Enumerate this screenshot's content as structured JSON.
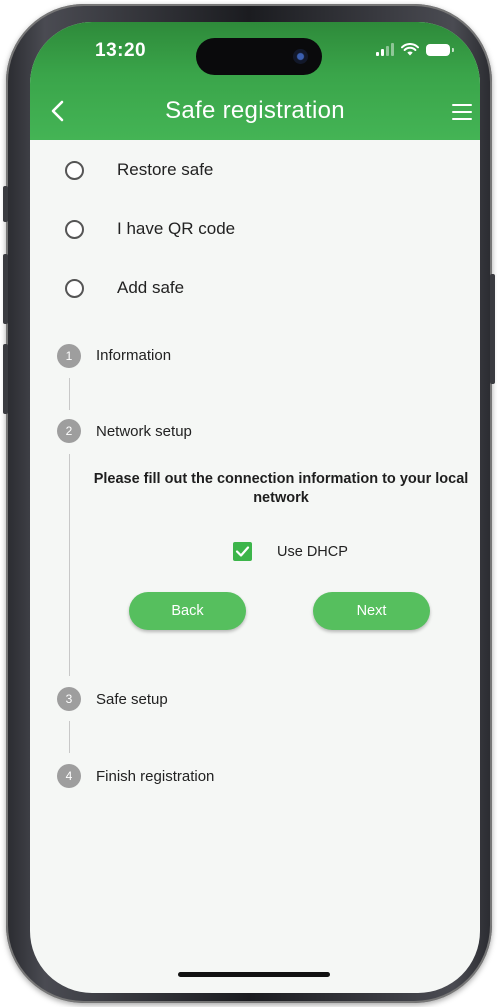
{
  "status_bar": {
    "time": "13:20"
  },
  "header": {
    "title": "Safe registration"
  },
  "options": [
    {
      "label": "Restore safe"
    },
    {
      "label": "I have QR code"
    },
    {
      "label": "Add safe"
    }
  ],
  "steps": [
    {
      "number": "1",
      "label": "Information"
    },
    {
      "number": "2",
      "label": "Network setup"
    },
    {
      "number": "3",
      "label": "Safe setup"
    },
    {
      "number": "4",
      "label": "Finish registration"
    }
  ],
  "network_setup": {
    "instruction": "Please fill out the connection information to your local network",
    "dhcp_label": "Use DHCP",
    "dhcp_checked": true,
    "back_label": "Back",
    "next_label": "Next"
  },
  "colors": {
    "accent": "#3cb54a",
    "header": "#3aa54a",
    "step_circle": "#9e9e9e"
  }
}
